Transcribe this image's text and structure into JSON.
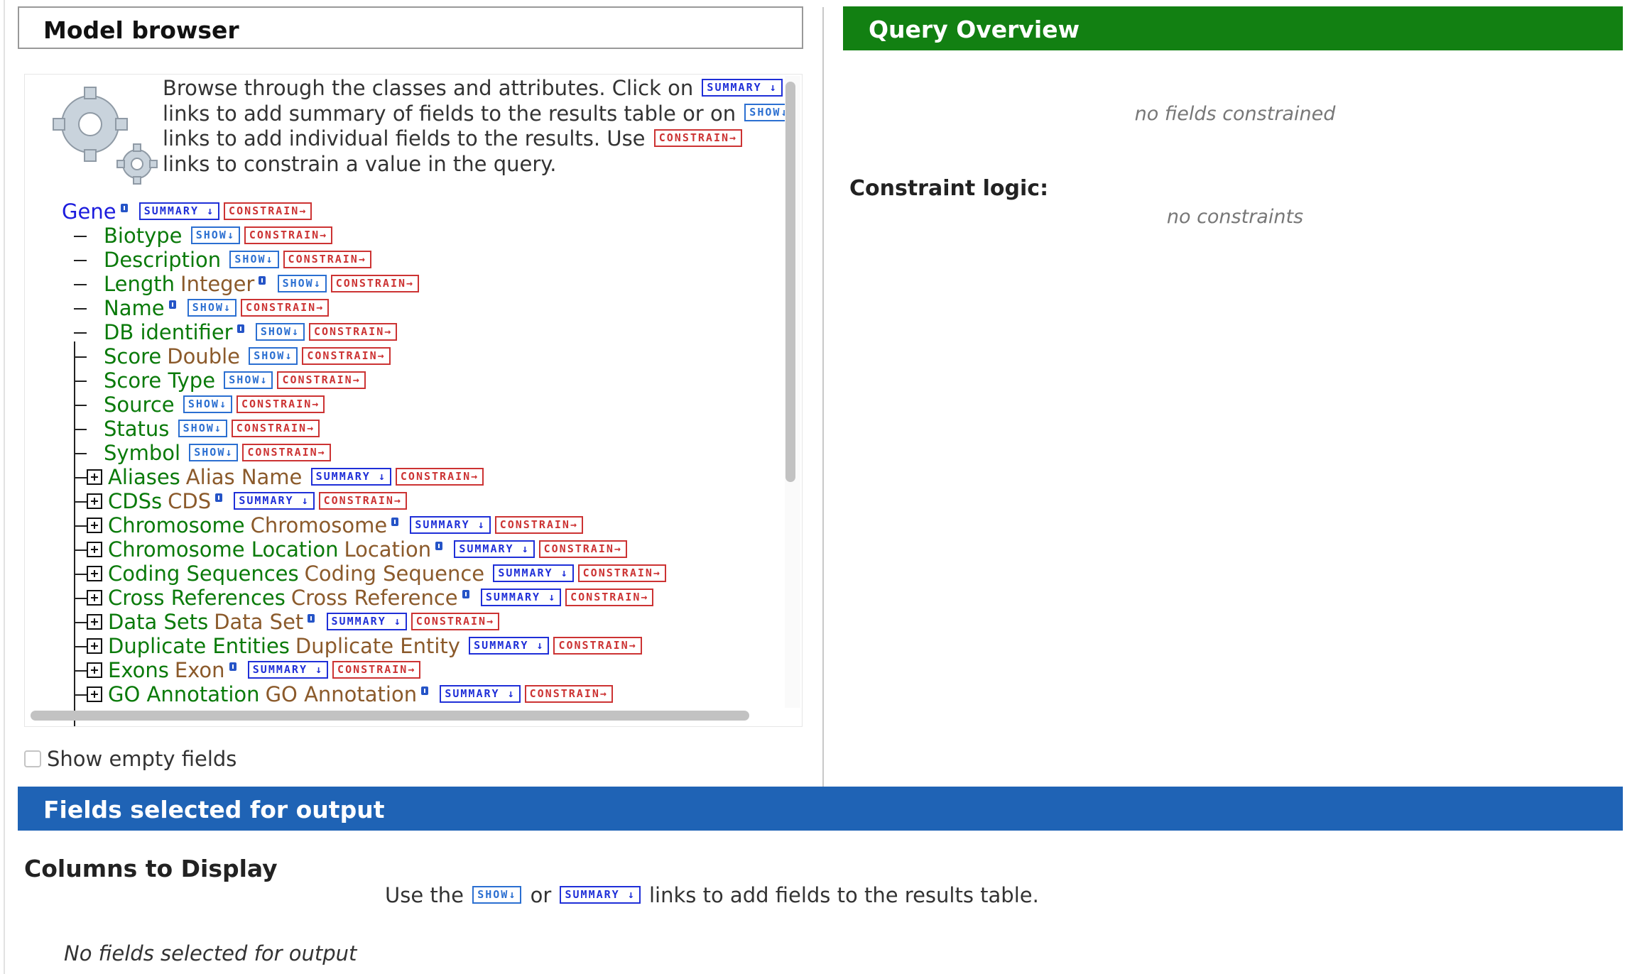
{
  "model_browser": {
    "title": "Model browser",
    "intro": {
      "line1_pre": "Browse through the classes and attributes. Click on",
      "line2_pre": "links to add summary of fields to the results table or on",
      "line3_pre": "links to add individual fields to the results. Use",
      "line4": "links to constrain a value in the query."
    },
    "tags": {
      "summary": "SUMMARY ↓",
      "show": "SHOW↓",
      "constrain": "CONSTRAIN→"
    },
    "root": {
      "name": "Gene"
    },
    "attributes": [
      {
        "name": "Biotype",
        "type": "",
        "info": false
      },
      {
        "name": "Description",
        "type": "",
        "info": false
      },
      {
        "name": "Length",
        "type": "Integer",
        "info": true
      },
      {
        "name": "Name",
        "type": "",
        "info": true
      },
      {
        "name": "DB identifier",
        "type": "",
        "info": true
      },
      {
        "name": "Score",
        "type": "Double",
        "info": false
      },
      {
        "name": "Score Type",
        "type": "",
        "info": false
      },
      {
        "name": "Source",
        "type": "",
        "info": false
      },
      {
        "name": "Status",
        "type": "",
        "info": false
      },
      {
        "name": "Symbol",
        "type": "",
        "info": false
      }
    ],
    "references": [
      {
        "name": "Aliases",
        "type": "Alias Name",
        "info": false
      },
      {
        "name": "CDSs",
        "type": "CDS",
        "info": true
      },
      {
        "name": "Chromosome",
        "type": "Chromosome",
        "info": true
      },
      {
        "name": "Chromosome Location",
        "type": "Location",
        "info": true
      },
      {
        "name": "Coding Sequences",
        "type": "Coding Sequence",
        "info": false
      },
      {
        "name": "Cross References",
        "type": "Cross Reference",
        "info": true
      },
      {
        "name": "Data Sets",
        "type": "Data Set",
        "info": true
      },
      {
        "name": "Duplicate Entities",
        "type": "Duplicate Entity",
        "info": false
      },
      {
        "name": "Exons",
        "type": "Exon",
        "info": true
      },
      {
        "name": "GO Annotation",
        "type": "GO Annotation",
        "info": true
      }
    ],
    "show_empty_fields_label": "Show empty fields"
  },
  "query_overview": {
    "title": "Query Overview",
    "no_fields_text": "no fields constrained",
    "constraint_logic_label": "Constraint logic:",
    "no_constraints_text": "no constraints"
  },
  "fields_selected": {
    "title": "Fields selected for output",
    "columns_label": "Columns to Display",
    "hint_use_the": "Use the",
    "hint_or": "or",
    "hint_tail": "links to add fields to the results table.",
    "no_fields_text": "No fields selected for output"
  },
  "colors": {
    "query_header_bg": "#128012",
    "fields_header_bg": "#1f63b5",
    "field_name": "#0a7a0a",
    "field_type": "#8b5a2b",
    "root_class": "#1c1cdd",
    "summary_tag": "#1f2fd8",
    "show_tag": "#2b6fd1",
    "constrain_tag": "#cc3333"
  }
}
